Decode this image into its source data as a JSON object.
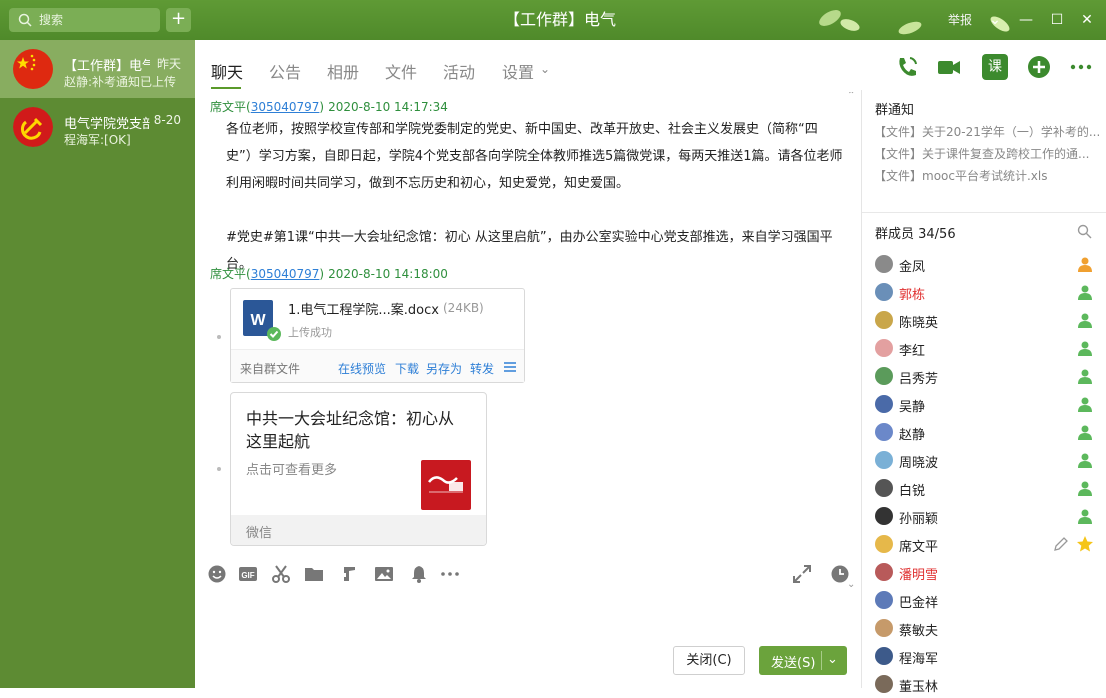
{
  "window": {
    "title": "【工作群】电气",
    "report_label": "举报",
    "search_placeholder": "搜索",
    "add_label": "+"
  },
  "conversations": [
    {
      "name": "【工作群】电气",
      "time": "昨天",
      "preview": "赵静:补考通知已上传"
    },
    {
      "name": "电气学院党支部",
      "time": "8-20",
      "preview": "程海军:[OK]"
    }
  ],
  "tabs": [
    "聊天",
    "公告",
    "相册",
    "文件",
    "活动",
    "设置"
  ],
  "messages": {
    "m1": {
      "sender": "席文平",
      "qq": "305040797",
      "time": "2020-8-10 14:17:34",
      "lines": [
        "各位老师，按照学校宣传部和学院党委制定的党史、新中国史、改革开放史、社会主义发展史（简称“四",
        "史”）学习方案，自即日起，学院4个党支部各向学院全体教师推选5篇微党课，每两天推送1篇。请各位老师",
        "利用闲暇时间共同学习，做到不忘历史和初心，知史爱党，知史爱国。",
        "",
        "#党史#第1课“中共一大会址纪念馆：初心 从这里启航”，由办公室实验中心党支部推选，来自学习强国平",
        "台。"
      ]
    },
    "m2": {
      "sender": "席文平",
      "qq": "305040797",
      "time": "2020-8-10 14:18:00",
      "file": {
        "name": "1.电气工程学院...案.docx",
        "size": "(24KB)",
        "status": "上传成功",
        "from": "来自群文件",
        "actions": [
          "在线预览",
          "下载",
          "另存为",
          "转发"
        ]
      },
      "link": {
        "title": "中共一大会址纪念馆：初心从这里起航",
        "subtitle": "点击可查看更多",
        "source": "微信"
      }
    }
  },
  "composer": {
    "close_label": "关闭(C)",
    "send_label": "发送(S)"
  },
  "group_notice": {
    "title": "群通知",
    "items": [
      "【文件】关于20-21学年（一）学补考的...",
      "【文件】关于课件复查及跨校工作的通...",
      "【文件】mooc平台考试统计.xls"
    ]
  },
  "members": {
    "title": "群成员 34/56",
    "list": [
      {
        "name": "金凤",
        "role": "owner",
        "red": false
      },
      {
        "name": "郭栋",
        "role": "admin",
        "red": true
      },
      {
        "name": "陈晓英",
        "role": "admin",
        "red": false
      },
      {
        "name": "李红",
        "role": "admin",
        "red": false
      },
      {
        "name": "吕秀芳",
        "role": "admin",
        "red": false
      },
      {
        "name": "吴静",
        "role": "admin",
        "red": false
      },
      {
        "name": "赵静",
        "role": "admin",
        "red": false
      },
      {
        "name": "周晓波",
        "role": "admin",
        "red": false
      },
      {
        "name": "白锐",
        "role": "admin",
        "red": false
      },
      {
        "name": "孙丽颖",
        "role": "admin",
        "red": false
      },
      {
        "name": "席文平",
        "role": "me",
        "red": false
      },
      {
        "name": "潘明雪",
        "role": "",
        "red": true
      },
      {
        "name": "巴金祥",
        "role": "",
        "red": false
      },
      {
        "name": "蔡敏夫",
        "role": "",
        "red": false
      },
      {
        "name": "程海军",
        "role": "",
        "red": false
      },
      {
        "name": "董玉林",
        "role": "",
        "red": false
      }
    ]
  },
  "colors": {
    "brand_green": "#5d8b33",
    "link_blue": "#2e7fd6",
    "send_green": "#6ba33c"
  }
}
